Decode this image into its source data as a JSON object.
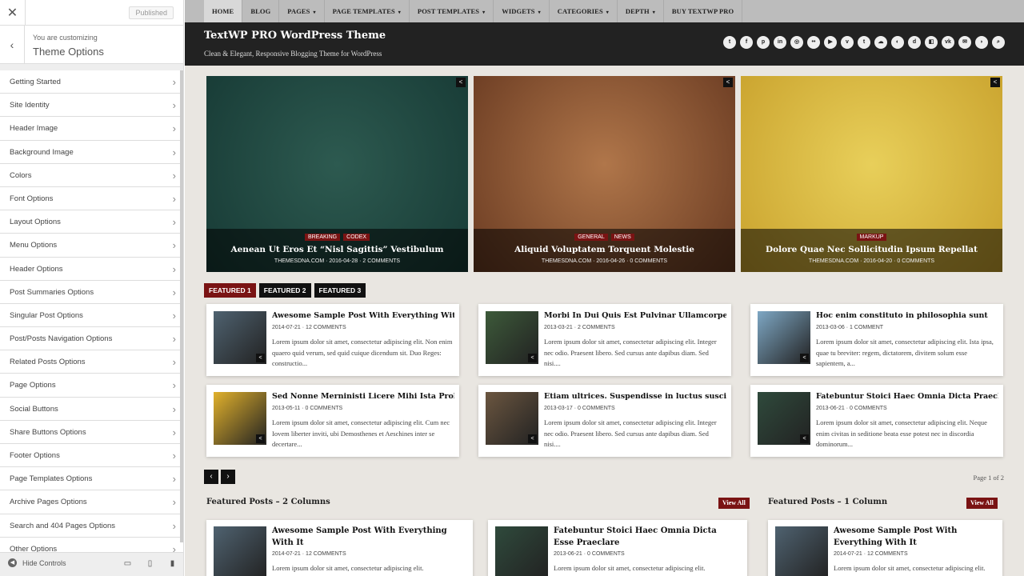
{
  "sidebar": {
    "close_glyph": "✕",
    "published_label": "Published",
    "back_glyph": "‹",
    "info_pre": "You are customizing",
    "info_title": "Theme Options",
    "items": [
      {
        "label": "Getting Started"
      },
      {
        "label": "Site Identity"
      },
      {
        "label": "Header Image"
      },
      {
        "label": "Background Image"
      },
      {
        "label": "Colors"
      },
      {
        "label": "Font Options"
      },
      {
        "label": "Layout Options"
      },
      {
        "label": "Menu Options"
      },
      {
        "label": "Header Options"
      },
      {
        "label": "Post Summaries Options"
      },
      {
        "label": "Singular Post Options"
      },
      {
        "label": "Post/Posts Navigation Options"
      },
      {
        "label": "Related Posts Options"
      },
      {
        "label": "Page Options"
      },
      {
        "label": "Social Buttons"
      },
      {
        "label": "Share Buttons Options"
      },
      {
        "label": "Footer Options"
      },
      {
        "label": "Page Templates Options"
      },
      {
        "label": "Archive Pages Options"
      },
      {
        "label": "Search and 404 Pages Options"
      },
      {
        "label": "Other Options"
      }
    ],
    "hide_controls": "Hide Controls"
  },
  "nav": {
    "items": [
      {
        "label": "HOME",
        "dd": ""
      },
      {
        "label": "BLOG",
        "dd": ""
      },
      {
        "label": "PAGES",
        "dd": "▾"
      },
      {
        "label": "PAGE TEMPLATES",
        "dd": "▾"
      },
      {
        "label": "POST TEMPLATES",
        "dd": "▾"
      },
      {
        "label": "WIDGETS",
        "dd": "▾"
      },
      {
        "label": "CATEGORIES",
        "dd": "▾"
      },
      {
        "label": "DEPTH",
        "dd": "▾"
      },
      {
        "label": "BUY TEXTWP PRO",
        "dd": ""
      }
    ]
  },
  "header": {
    "title": "TextWP PRO WordPress Theme",
    "tagline": "Clean & Elegant, Responsive Blogging Theme for WordPress",
    "social_icons": [
      "twitter-icon",
      "facebook-icon",
      "pinterest-icon",
      "linkedin-icon",
      "instagram-icon",
      "flickr-icon",
      "youtube-icon",
      "vimeo-icon",
      "tumblr-icon",
      "soundcloud-icon",
      "github-icon",
      "digg-icon",
      "delicious-icon",
      "vk-icon",
      "email-icon",
      "rss-icon",
      "search-icon"
    ]
  },
  "slider": [
    {
      "cats": [
        "BREAKING",
        "CODEX"
      ],
      "title": "Aenean Ut Eros Et “Nisl Sagittis” Vestibulum",
      "meta": "THEMESDNA.COM · 2016-04-28 · 2 COMMENTS",
      "colors": [
        "#173a35",
        "#2d5a50"
      ]
    },
    {
      "cats": [
        "GENERAL",
        "NEWS"
      ],
      "title": "Aliquid Voluptatem Torquent Molestie",
      "meta": "THEMESDNA.COM · 2016-04-26 · 0 COMMENTS",
      "colors": [
        "#6a3b22",
        "#b0764a"
      ]
    },
    {
      "cats": [
        "MARKUP"
      ],
      "title": "Dolore Quae Nec Sollicitudin Ipsum Repellat",
      "meta": "THEMESDNA.COM · 2016-04-20 · 0 COMMENTS",
      "colors": [
        "#c9a22d",
        "#e8cf5a"
      ]
    }
  ],
  "featured_tabs": [
    "FEATURED 1",
    "FEATURED 2",
    "FEATURED 3"
  ],
  "cards": [
    {
      "title": "Awesome Sample Post With Everything With It",
      "date": "2014-07-21",
      "comments": "12 COMMENTS",
      "excerpt": "Lorem ipsum dolor sit amet, consectetur adipiscing elit. Non enim quaero quid verum, sed quid cuique dicendum sit. Duo Reges: constructio...",
      "color": "#4f6270"
    },
    {
      "title": "Morbi In Dui Quis Est Pulvinar Ullamcorper",
      "date": "2013-03-21",
      "comments": "2 COMMENTS",
      "excerpt": "Lorem ipsum dolor sit amet, consectetur adipiscing elit. Integer nec odio. Praesent libero. Sed cursus ante dapibus diam. Sed nisi....",
      "color": "#3d5a3a"
    },
    {
      "title": "Hoc enim constituto in philosophia sunt",
      "date": "2013-03-06",
      "comments": "1 COMMENT",
      "excerpt": "Lorem ipsum dolor sit amet, consectetur adipiscing elit. Ista ipsa, quae tu breviter: regem, dictatorem, divitem solum esse sapientem, a...",
      "color": "#7ea7c4"
    },
    {
      "title": "Sed Nonne Merninisti Licere Mihi Ista Probare",
      "date": "2013-05-11",
      "comments": "0 COMMENTS",
      "excerpt": "Lorem ipsum dolor sit amet, consectetur adipiscing elit. Cum nec Iovem liberter inviti, ubi Demosthenes et Aeschines inter se decertare...",
      "color": "#e1b12c"
    },
    {
      "title": "Etiam ultrices. Suspendisse in luctus suscipit",
      "date": "2013-03-17",
      "comments": "0 COMMENTS",
      "excerpt": "Lorem ipsum dolor sit amet, consectetur adipiscing elit. Integer nec odio. Praesent libero. Sed cursus ante dapibus diam. Sed nisi....",
      "color": "#6b5640"
    },
    {
      "title": "Fatebuntur Stoici Haec Omnia Dicta Praeclare",
      "date": "2013-06-21",
      "comments": "0 COMMENTS",
      "excerpt": "Lorem ipsum dolor sit amet, consectetur adipiscing elit. Neque enim civitas in seditione beata esse potest nec in discordia dominorum...",
      "color": "#2f4a3c"
    }
  ],
  "pager": {
    "prev": "‹",
    "next": "›",
    "page_of": "Page 1 of 2"
  },
  "sections": [
    {
      "title": "Featured Posts – 2 Columns",
      "view_all": "View All"
    },
    {
      "title": "Featured Posts – 1 Column",
      "view_all": "View All"
    }
  ],
  "bottom_cards": [
    {
      "title": "Awesome Sample Post With Everything With It",
      "date": "2014-07-21",
      "comments": "12 COMMENTS",
      "excerpt": "Lorem ipsum dolor sit amet, consectetur adipiscing elit.",
      "color": "#4f6270"
    },
    {
      "title": "Fatebuntur Stoici Haec Omnia Dicta Esse Praeclare",
      "date": "2013-06-21",
      "comments": "0 COMMENTS",
      "excerpt": "Lorem ipsum dolor sit amet, consectetur adipiscing elit.",
      "color": "#2f4a3c"
    },
    {
      "title": "Awesome Sample Post With Everything With It",
      "date": "2014-07-21",
      "comments": "12 COMMENTS",
      "excerpt": "Lorem ipsum dolor sit amet, consectetur adipiscing elit.",
      "color": "#4f6270"
    }
  ],
  "colors": {
    "accent": "#7a1313",
    "header_bg": "#222222",
    "nav_bg": "#bcbcbc"
  }
}
